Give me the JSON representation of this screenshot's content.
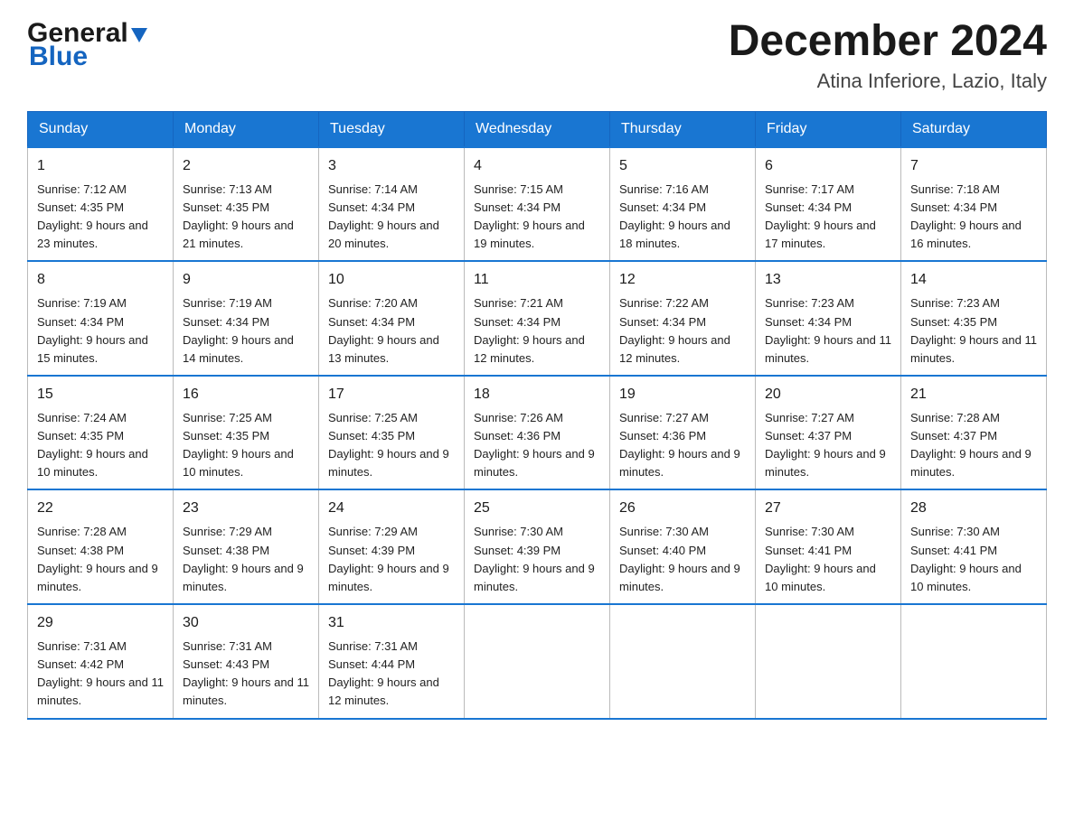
{
  "header": {
    "logo_general": "General",
    "logo_blue": "Blue",
    "title": "December 2024",
    "location": "Atina Inferiore, Lazio, Italy"
  },
  "weekdays": [
    "Sunday",
    "Monday",
    "Tuesday",
    "Wednesday",
    "Thursday",
    "Friday",
    "Saturday"
  ],
  "weeks": [
    [
      {
        "day": "1",
        "sunrise": "Sunrise: 7:12 AM",
        "sunset": "Sunset: 4:35 PM",
        "daylight": "Daylight: 9 hours and 23 minutes."
      },
      {
        "day": "2",
        "sunrise": "Sunrise: 7:13 AM",
        "sunset": "Sunset: 4:35 PM",
        "daylight": "Daylight: 9 hours and 21 minutes."
      },
      {
        "day": "3",
        "sunrise": "Sunrise: 7:14 AM",
        "sunset": "Sunset: 4:34 PM",
        "daylight": "Daylight: 9 hours and 20 minutes."
      },
      {
        "day": "4",
        "sunrise": "Sunrise: 7:15 AM",
        "sunset": "Sunset: 4:34 PM",
        "daylight": "Daylight: 9 hours and 19 minutes."
      },
      {
        "day": "5",
        "sunrise": "Sunrise: 7:16 AM",
        "sunset": "Sunset: 4:34 PM",
        "daylight": "Daylight: 9 hours and 18 minutes."
      },
      {
        "day": "6",
        "sunrise": "Sunrise: 7:17 AM",
        "sunset": "Sunset: 4:34 PM",
        "daylight": "Daylight: 9 hours and 17 minutes."
      },
      {
        "day": "7",
        "sunrise": "Sunrise: 7:18 AM",
        "sunset": "Sunset: 4:34 PM",
        "daylight": "Daylight: 9 hours and 16 minutes."
      }
    ],
    [
      {
        "day": "8",
        "sunrise": "Sunrise: 7:19 AM",
        "sunset": "Sunset: 4:34 PM",
        "daylight": "Daylight: 9 hours and 15 minutes."
      },
      {
        "day": "9",
        "sunrise": "Sunrise: 7:19 AM",
        "sunset": "Sunset: 4:34 PM",
        "daylight": "Daylight: 9 hours and 14 minutes."
      },
      {
        "day": "10",
        "sunrise": "Sunrise: 7:20 AM",
        "sunset": "Sunset: 4:34 PM",
        "daylight": "Daylight: 9 hours and 13 minutes."
      },
      {
        "day": "11",
        "sunrise": "Sunrise: 7:21 AM",
        "sunset": "Sunset: 4:34 PM",
        "daylight": "Daylight: 9 hours and 12 minutes."
      },
      {
        "day": "12",
        "sunrise": "Sunrise: 7:22 AM",
        "sunset": "Sunset: 4:34 PM",
        "daylight": "Daylight: 9 hours and 12 minutes."
      },
      {
        "day": "13",
        "sunrise": "Sunrise: 7:23 AM",
        "sunset": "Sunset: 4:34 PM",
        "daylight": "Daylight: 9 hours and 11 minutes."
      },
      {
        "day": "14",
        "sunrise": "Sunrise: 7:23 AM",
        "sunset": "Sunset: 4:35 PM",
        "daylight": "Daylight: 9 hours and 11 minutes."
      }
    ],
    [
      {
        "day": "15",
        "sunrise": "Sunrise: 7:24 AM",
        "sunset": "Sunset: 4:35 PM",
        "daylight": "Daylight: 9 hours and 10 minutes."
      },
      {
        "day": "16",
        "sunrise": "Sunrise: 7:25 AM",
        "sunset": "Sunset: 4:35 PM",
        "daylight": "Daylight: 9 hours and 10 minutes."
      },
      {
        "day": "17",
        "sunrise": "Sunrise: 7:25 AM",
        "sunset": "Sunset: 4:35 PM",
        "daylight": "Daylight: 9 hours and 9 minutes."
      },
      {
        "day": "18",
        "sunrise": "Sunrise: 7:26 AM",
        "sunset": "Sunset: 4:36 PM",
        "daylight": "Daylight: 9 hours and 9 minutes."
      },
      {
        "day": "19",
        "sunrise": "Sunrise: 7:27 AM",
        "sunset": "Sunset: 4:36 PM",
        "daylight": "Daylight: 9 hours and 9 minutes."
      },
      {
        "day": "20",
        "sunrise": "Sunrise: 7:27 AM",
        "sunset": "Sunset: 4:37 PM",
        "daylight": "Daylight: 9 hours and 9 minutes."
      },
      {
        "day": "21",
        "sunrise": "Sunrise: 7:28 AM",
        "sunset": "Sunset: 4:37 PM",
        "daylight": "Daylight: 9 hours and 9 minutes."
      }
    ],
    [
      {
        "day": "22",
        "sunrise": "Sunrise: 7:28 AM",
        "sunset": "Sunset: 4:38 PM",
        "daylight": "Daylight: 9 hours and 9 minutes."
      },
      {
        "day": "23",
        "sunrise": "Sunrise: 7:29 AM",
        "sunset": "Sunset: 4:38 PM",
        "daylight": "Daylight: 9 hours and 9 minutes."
      },
      {
        "day": "24",
        "sunrise": "Sunrise: 7:29 AM",
        "sunset": "Sunset: 4:39 PM",
        "daylight": "Daylight: 9 hours and 9 minutes."
      },
      {
        "day": "25",
        "sunrise": "Sunrise: 7:30 AM",
        "sunset": "Sunset: 4:39 PM",
        "daylight": "Daylight: 9 hours and 9 minutes."
      },
      {
        "day": "26",
        "sunrise": "Sunrise: 7:30 AM",
        "sunset": "Sunset: 4:40 PM",
        "daylight": "Daylight: 9 hours and 9 minutes."
      },
      {
        "day": "27",
        "sunrise": "Sunrise: 7:30 AM",
        "sunset": "Sunset: 4:41 PM",
        "daylight": "Daylight: 9 hours and 10 minutes."
      },
      {
        "day": "28",
        "sunrise": "Sunrise: 7:30 AM",
        "sunset": "Sunset: 4:41 PM",
        "daylight": "Daylight: 9 hours and 10 minutes."
      }
    ],
    [
      {
        "day": "29",
        "sunrise": "Sunrise: 7:31 AM",
        "sunset": "Sunset: 4:42 PM",
        "daylight": "Daylight: 9 hours and 11 minutes."
      },
      {
        "day": "30",
        "sunrise": "Sunrise: 7:31 AM",
        "sunset": "Sunset: 4:43 PM",
        "daylight": "Daylight: 9 hours and 11 minutes."
      },
      {
        "day": "31",
        "sunrise": "Sunrise: 7:31 AM",
        "sunset": "Sunset: 4:44 PM",
        "daylight": "Daylight: 9 hours and 12 minutes."
      },
      null,
      null,
      null,
      null
    ]
  ]
}
